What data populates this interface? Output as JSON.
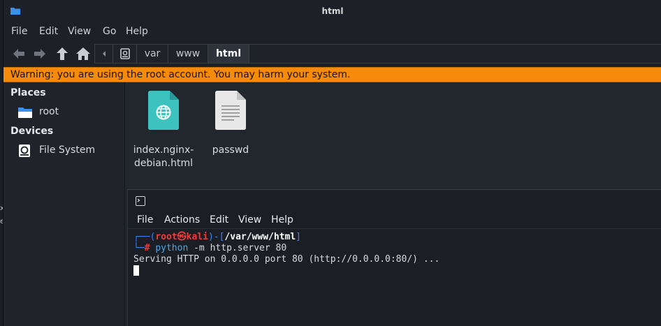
{
  "window": {
    "title": "html"
  },
  "menubar": {
    "items": [
      "File",
      "Edit",
      "View",
      "Go",
      "Help"
    ]
  },
  "toolbar": {
    "buttons": [
      "back-icon",
      "forward-icon",
      "up-icon",
      "home-icon"
    ],
    "path": [
      "var",
      "www",
      "html"
    ]
  },
  "warning": {
    "text": "Warning: you are using the root account. You may harm your system.",
    "color": "#f58a0b"
  },
  "sidebar": {
    "places_heading": "Places",
    "places": [
      {
        "label": "root",
        "icon": "folder-icon"
      }
    ],
    "devices_heading": "Devices",
    "devices": [
      {
        "label": "File System",
        "icon": "drive-icon"
      }
    ]
  },
  "files": [
    {
      "name_line1": "index.nginx-",
      "name_line2": "debian.html",
      "icon": "html-file-icon"
    },
    {
      "name_line1": "passwd",
      "name_line2": "",
      "icon": "text-file-icon"
    }
  ],
  "terminal": {
    "menu": [
      "File",
      "Actions",
      "Edit",
      "View",
      "Help"
    ],
    "prompt_open": "┌──(",
    "user": "root㉿kali",
    "prompt_mid": ")-[",
    "cwd": "/var/www/html",
    "prompt_close": "]",
    "prompt_second": "└─",
    "hash": "#",
    "command": "python",
    "args": " -m http.server 80",
    "output": "Serving HTTP on 0.0.0.0 port 80 (http://0.0.0.0:80/) ..."
  },
  "desktop_edge": {
    "fragment1": "x",
    "fragment2": "e"
  }
}
